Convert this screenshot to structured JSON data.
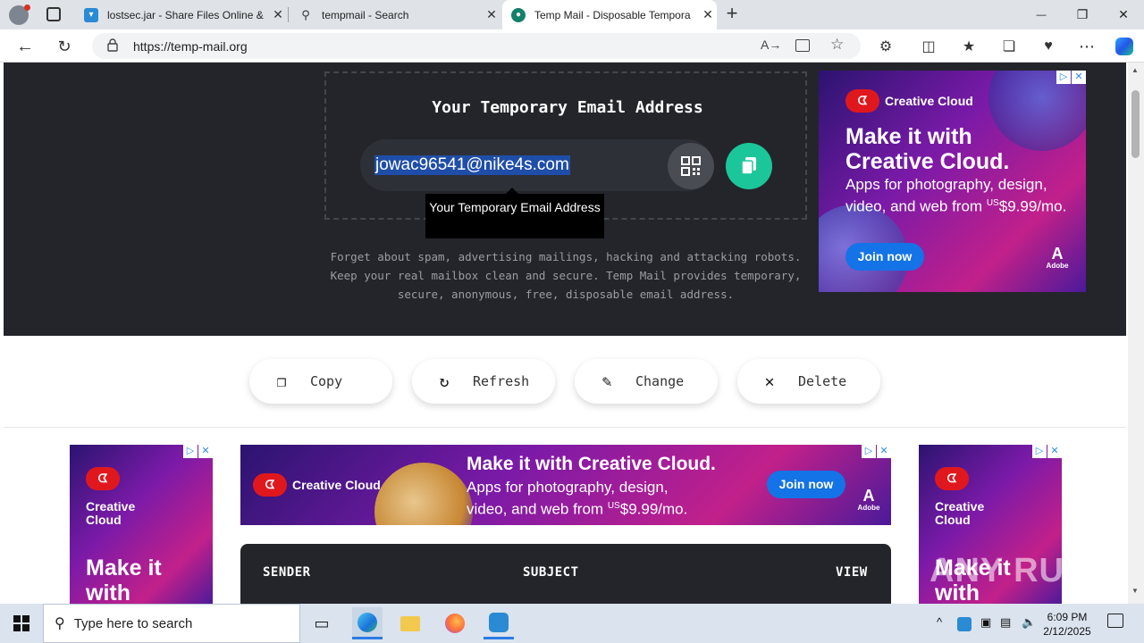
{
  "browser": {
    "tabs": [
      {
        "title": "lostsec.jar - Share Files Online &",
        "active": false
      },
      {
        "title": "tempmail - Search",
        "active": false
      },
      {
        "title": "Temp Mail - Disposable Tempora",
        "active": true
      }
    ],
    "new_tab": "+",
    "url": "https://temp-mail.org",
    "window_controls": {
      "minimize": "—",
      "maximize": "❐",
      "close": "✕"
    }
  },
  "hero": {
    "title": "Your Temporary Email Address",
    "email": "jowac96541@nike4s.com",
    "tooltip": "Your Temporary Email Address",
    "description": "Forget about spam, advertising mailings, hacking and attacking robots. Keep your real mailbox clean and secure. Temp Mail provides temporary, secure, anonymous, free, disposable email address."
  },
  "ads": {
    "brand": "Creative Cloud",
    "headline": "Make it with Creative Cloud.",
    "headline_short": "Make it with",
    "body": "Apps for photography, design, video, and web from",
    "price_prefix": "US",
    "price": "$9.99/mo.",
    "cta": "Join now",
    "adobe": "Adobe",
    "close_icons": [
      "▷",
      "✕"
    ]
  },
  "actions": [
    {
      "label": "Copy",
      "icon": "copy-icon"
    },
    {
      "label": "Refresh",
      "icon": "refresh-icon"
    },
    {
      "label": "Change",
      "icon": "edit-icon"
    },
    {
      "label": "Delete",
      "icon": "close-icon"
    }
  ],
  "inbox": {
    "sender": "SENDER",
    "subject": "SUBJECT",
    "view": "VIEW"
  },
  "watermark": "ANY RUN",
  "taskbar": {
    "search_placeholder": "Type here to search",
    "time": "6:09 PM",
    "date": "2/12/2025"
  }
}
